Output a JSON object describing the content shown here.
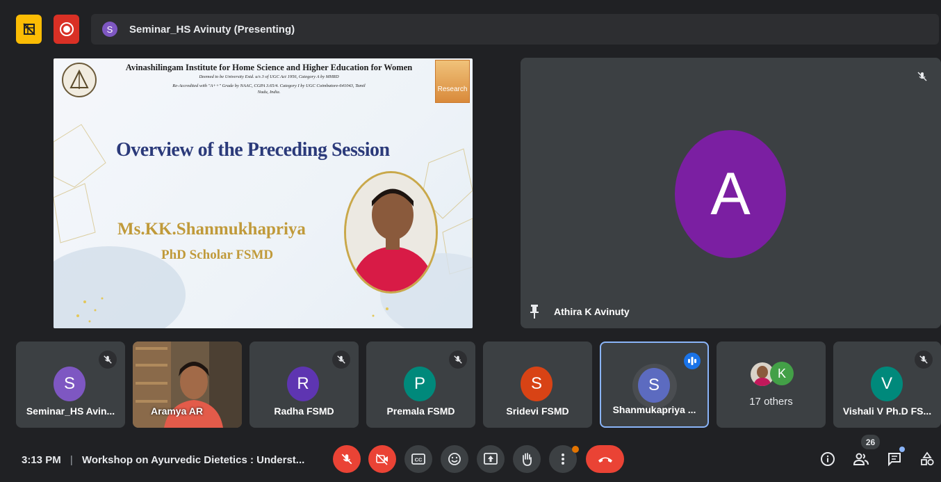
{
  "top": {
    "presenting_initial": "S",
    "presenting_text": "Seminar_HS Avinuty (Presenting)"
  },
  "slide": {
    "institution": "Avinashilingam Institute for Home Science and Higher Education for Women",
    "line2": "Deemed to be University Estd. u/s 3 of UGC Act 1956, Category A by MHRD",
    "line3": "Re-Accredited with \"A++\" Grade by NAAC, CGPA 3.65/4. Category I by UGC Coimbatore-641043, Tamil",
    "line4": "Nadu, India.",
    "logo_text": "Research",
    "heading": "Overview of the Preceding Session",
    "speaker": "Ms.KK.Shanmukhapriya",
    "role": "PhD Scholar FSMD"
  },
  "big_tile": {
    "initial": "A",
    "name": "Athira K Avinuty",
    "avatar_color": "#7b1fa2"
  },
  "tiles": [
    {
      "initial": "S",
      "name": "Seminar_HS Avin...",
      "color": "#7e57c2"
    },
    {
      "initial": "",
      "name": "Aramya AR",
      "color": ""
    },
    {
      "initial": "R",
      "name": "Radha FSMD",
      "color": "#5e35b1"
    },
    {
      "initial": "P",
      "name": "Premala FSMD",
      "color": "#00897b"
    },
    {
      "initial": "S",
      "name": "Sridevi FSMD",
      "color": "#d84315"
    },
    {
      "initial": "S",
      "name": "Shanmukapriya ...",
      "color": "#5c6bc0"
    },
    {
      "initial": "K",
      "name": "17 others",
      "color": "#43a047"
    },
    {
      "initial": "V",
      "name": "Vishali V Ph.D FS...",
      "color": "#00897b"
    }
  ],
  "bottom": {
    "time": "3:13 PM",
    "separator": "|",
    "meeting_title": "Workshop on Ayurvedic Dietetics : Underst...",
    "participants_count": "26"
  },
  "colors": {
    "background": "#202124",
    "tile": "#3c4043",
    "red": "#ea4335",
    "active_border": "#8ab4f8"
  }
}
